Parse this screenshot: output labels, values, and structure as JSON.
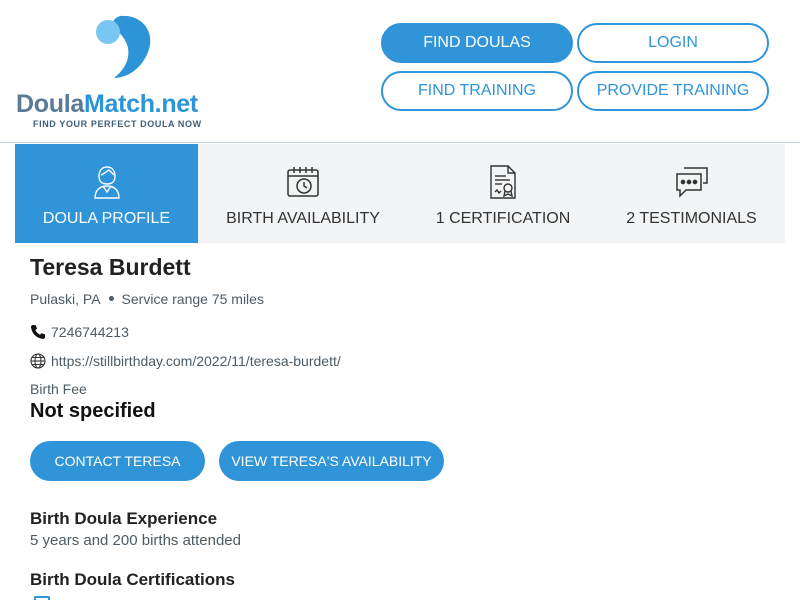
{
  "brand": {
    "name_part1": "Doula",
    "name_part2": "Match.net",
    "tagline": "FIND YOUR PERFECT DOULA NOW",
    "colors": {
      "primary": "#2f95d8",
      "dark": "#5b7a95",
      "light": "#79c6f2"
    }
  },
  "nav": {
    "find_doulas": "FIND DOULAS",
    "login": "LOGIN",
    "find_training": "FIND TRAINING",
    "provide_training": "PROVIDE TRAINING"
  },
  "tabs": [
    {
      "label": "DOULA PROFILE",
      "icon": "doula-person-icon",
      "active": true
    },
    {
      "label": "BIRTH AVAILABILITY",
      "icon": "calendar-clock-icon",
      "active": false
    },
    {
      "label": "1 CERTIFICATION",
      "icon": "certificate-document-icon",
      "active": false
    },
    {
      "label": "2 TESTIMONIALS",
      "icon": "chat-bubbles-icon",
      "active": false
    }
  ],
  "profile": {
    "name": "Teresa Burdett",
    "location": "Pulaski, PA",
    "service_range": "Service range 75 miles",
    "phone": "7246744213",
    "website": "https://stillbirthday.com/2022/11/teresa-burdett/",
    "fee_label": "Birth Fee",
    "fee_value": "Not specified"
  },
  "actions": {
    "contact": "CONTACT TERESA",
    "view_availability": "VIEW TERESA'S AVAILABILITY"
  },
  "sections": {
    "experience_title": "Birth Doula Experience",
    "experience_text": "5 years and 200 births attended",
    "certifications_title": "Birth Doula Certifications"
  }
}
